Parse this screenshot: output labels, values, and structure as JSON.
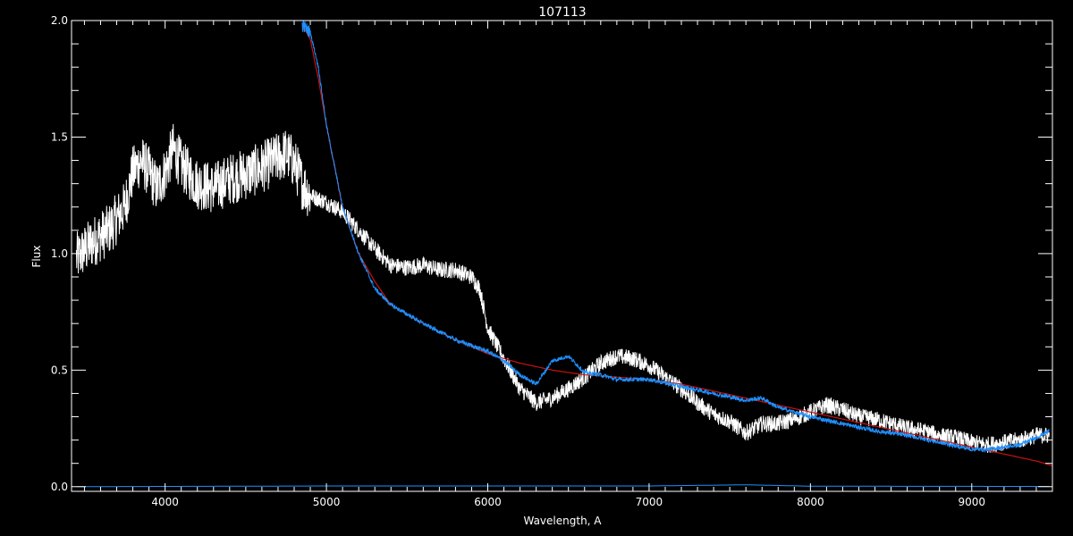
{
  "chart_data": {
    "type": "line",
    "title": "107113",
    "xlabel": "Wavelength, A",
    "ylabel": "Flux",
    "xlim": [
      3420,
      9500
    ],
    "ylim": [
      -0.02,
      2.0
    ],
    "xticks": [
      4000,
      5000,
      6000,
      7000,
      8000,
      9000
    ],
    "yticks": [
      0.0,
      0.5,
      1.0,
      1.5,
      2.0
    ],
    "ytick_labels": [
      "0.0",
      "0.5",
      "1.0",
      "1.5",
      "2.0"
    ],
    "grid": false,
    "background": "#000000",
    "series": [
      {
        "color": "#ffffff",
        "noise": 0.08,
        "x": [
          3450,
          3550,
          3650,
          3750,
          3800,
          3850,
          3900,
          3950,
          4000,
          4050,
          4100,
          4200,
          4300,
          4400,
          4500,
          4600,
          4700,
          4750,
          4800,
          4850,
          4900,
          5000,
          5100,
          5200,
          5300,
          5400,
          5500,
          5600,
          5700,
          5800,
          5900,
          5950,
          6000,
          6100,
          6200,
          6300,
          6400,
          6500,
          6600,
          6700,
          6800,
          6900,
          7000,
          7100,
          7200,
          7300,
          7400,
          7500,
          7600,
          7700,
          7800,
          7900,
          8000,
          8100,
          8200,
          8300,
          8400,
          8500,
          8600,
          8700,
          8800,
          8900,
          9000,
          9100,
          9200,
          9300,
          9400,
          9480
        ],
        "y": [
          0.98,
          1.05,
          1.1,
          1.2,
          1.35,
          1.4,
          1.35,
          1.28,
          1.35,
          1.45,
          1.38,
          1.3,
          1.28,
          1.32,
          1.34,
          1.37,
          1.41,
          1.43,
          1.39,
          1.3,
          1.25,
          1.22,
          1.18,
          1.1,
          1.02,
          0.95,
          0.94,
          0.95,
          0.93,
          0.93,
          0.9,
          0.85,
          0.68,
          0.55,
          0.42,
          0.36,
          0.38,
          0.42,
          0.47,
          0.53,
          0.56,
          0.55,
          0.52,
          0.47,
          0.42,
          0.36,
          0.31,
          0.28,
          0.23,
          0.27,
          0.27,
          0.29,
          0.32,
          0.35,
          0.33,
          0.3,
          0.29,
          0.27,
          0.25,
          0.24,
          0.22,
          0.21,
          0.19,
          0.18,
          0.19,
          0.2,
          0.22,
          0.22
        ]
      },
      {
        "color": "#cc1111",
        "noise": 0.0,
        "x": [
          4850,
          4900,
          4950,
          5000,
          5100,
          5200,
          5300,
          5400,
          5600,
          5800,
          6000,
          6200,
          6400,
          6600,
          6800,
          7000,
          7200,
          7400,
          7600,
          7800,
          8000,
          8200,
          8400,
          8600,
          8800,
          9000,
          9200,
          9400,
          9500
        ],
        "y": [
          1.98,
          1.92,
          1.75,
          1.55,
          1.2,
          1.0,
          0.88,
          0.78,
          0.7,
          0.63,
          0.57,
          0.53,
          0.5,
          0.48,
          0.47,
          0.46,
          0.44,
          0.41,
          0.38,
          0.35,
          0.32,
          0.29,
          0.26,
          0.23,
          0.2,
          0.17,
          0.14,
          0.11,
          0.09
        ]
      },
      {
        "color": "#1e90ff",
        "noise": 0.02,
        "x": [
          4850,
          4900,
          4950,
          5000,
          5100,
          5200,
          5300,
          5400,
          5600,
          5800,
          6000,
          6100,
          6200,
          6300,
          6400,
          6500,
          6600,
          6700,
          6800,
          7000,
          7200,
          7400,
          7600,
          7700,
          7800,
          8000,
          8200,
          8400,
          8600,
          8800,
          9000,
          9100,
          9200,
          9300,
          9400,
          9480
        ],
        "y": [
          1.98,
          1.95,
          1.8,
          1.55,
          1.2,
          1.0,
          0.85,
          0.78,
          0.7,
          0.63,
          0.58,
          0.54,
          0.48,
          0.44,
          0.54,
          0.56,
          0.49,
          0.48,
          0.46,
          0.46,
          0.43,
          0.4,
          0.37,
          0.38,
          0.34,
          0.3,
          0.27,
          0.24,
          0.22,
          0.19,
          0.16,
          0.16,
          0.17,
          0.18,
          0.21,
          0.24
        ]
      },
      {
        "color": "#1e90ff",
        "noise": 0.0,
        "x": [
          3450,
          5000,
          7000,
          7600,
          8000,
          9480
        ],
        "y": [
          0.0,
          0.003,
          0.003,
          0.008,
          0.002,
          0.001
        ]
      }
    ]
  }
}
